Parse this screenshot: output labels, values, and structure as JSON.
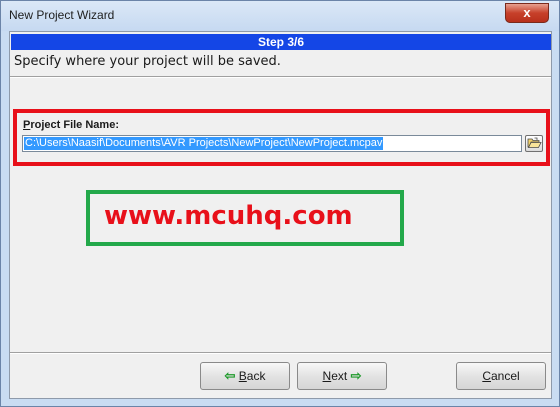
{
  "window": {
    "title": "New Project Wizard",
    "close_glyph": "x"
  },
  "wizard": {
    "step": "Step 3/6",
    "instruction": "Specify where your project will be saved."
  },
  "field": {
    "label_hotkey": "P",
    "label_rest": "roject File Name:",
    "value": "C:\\Users\\Naasif\\Documents\\AVR Projects\\NewProject\\NewProject.mcpav",
    "browse_icon": "folder-open-icon"
  },
  "watermark": {
    "text": "www.mcuhq.com"
  },
  "buttons": {
    "back_arrow": "⇦",
    "back_hotkey": "B",
    "back_rest": "ack",
    "next_hotkey": "N",
    "next_rest": "ext",
    "next_arrow": "⇨",
    "cancel_hotkey": "C",
    "cancel_rest": "ancel"
  },
  "colors": {
    "step_bar": "#1446e6",
    "highlight_red": "#e8101a",
    "highlight_green": "#23a84a",
    "arrow_green": "#1e9a2a"
  }
}
